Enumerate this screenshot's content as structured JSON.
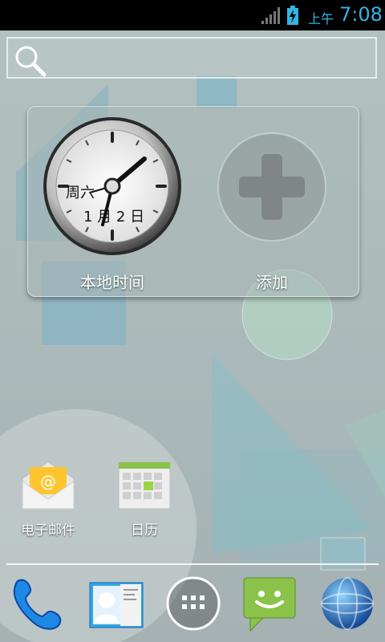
{
  "status_bar": {
    "ampm": "上午",
    "time": "7:08",
    "icons": [
      "signal-icon",
      "battery-charging-icon"
    ]
  },
  "search": {
    "icon": "search-icon"
  },
  "widget": {
    "clock_day": "周六",
    "clock_date": "1 月 2 日",
    "clock_label": "本地时间",
    "add_label": "添加",
    "add_icon": "plus-icon"
  },
  "apps": [
    {
      "label": "电子邮件",
      "icon": "email-icon"
    },
    {
      "label": "日历",
      "icon": "calendar-icon"
    }
  ],
  "dock": [
    {
      "icon": "phone-icon"
    },
    {
      "icon": "contacts-icon"
    },
    {
      "icon": "app-drawer-icon"
    },
    {
      "icon": "messaging-icon"
    },
    {
      "icon": "browser-icon"
    }
  ],
  "colors": {
    "accent": "#33b5e5",
    "status_bar": "#000000",
    "message_green": "#8bc34a"
  }
}
